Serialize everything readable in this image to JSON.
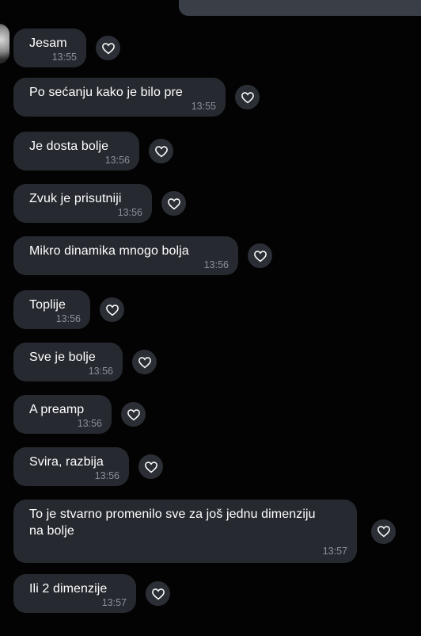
{
  "messages": [
    {
      "text": "Jesam",
      "time": "13:55"
    },
    {
      "text": "Po sećanju kako je bilo pre",
      "time": "13:55"
    },
    {
      "text": "Je dosta bolje",
      "time": "13:56"
    },
    {
      "text": "Zvuk je prisutniji",
      "time": "13:56"
    },
    {
      "text": "Mikro dinamika mnogo bolja",
      "time": "13:56"
    },
    {
      "text": "Toplije",
      "time": "13:56"
    },
    {
      "text": "Sve je bolje",
      "time": "13:56"
    },
    {
      "text": "A preamp",
      "time": "13:56"
    },
    {
      "text": "Svira, razbija",
      "time": "13:56"
    },
    {
      "text": "To je stvarno promenilo sve za još jednu dimenziju na bolje",
      "time": "13:57"
    },
    {
      "text": "Ili 2 dimenzije",
      "time": "13:57"
    }
  ],
  "icons": {
    "reaction": "heart-icon",
    "avatar": "avatar"
  },
  "colors": {
    "background": "#030303",
    "bubble": "#262a30",
    "time": "#8b8f96",
    "reaction_bg": "#2b2f35"
  }
}
